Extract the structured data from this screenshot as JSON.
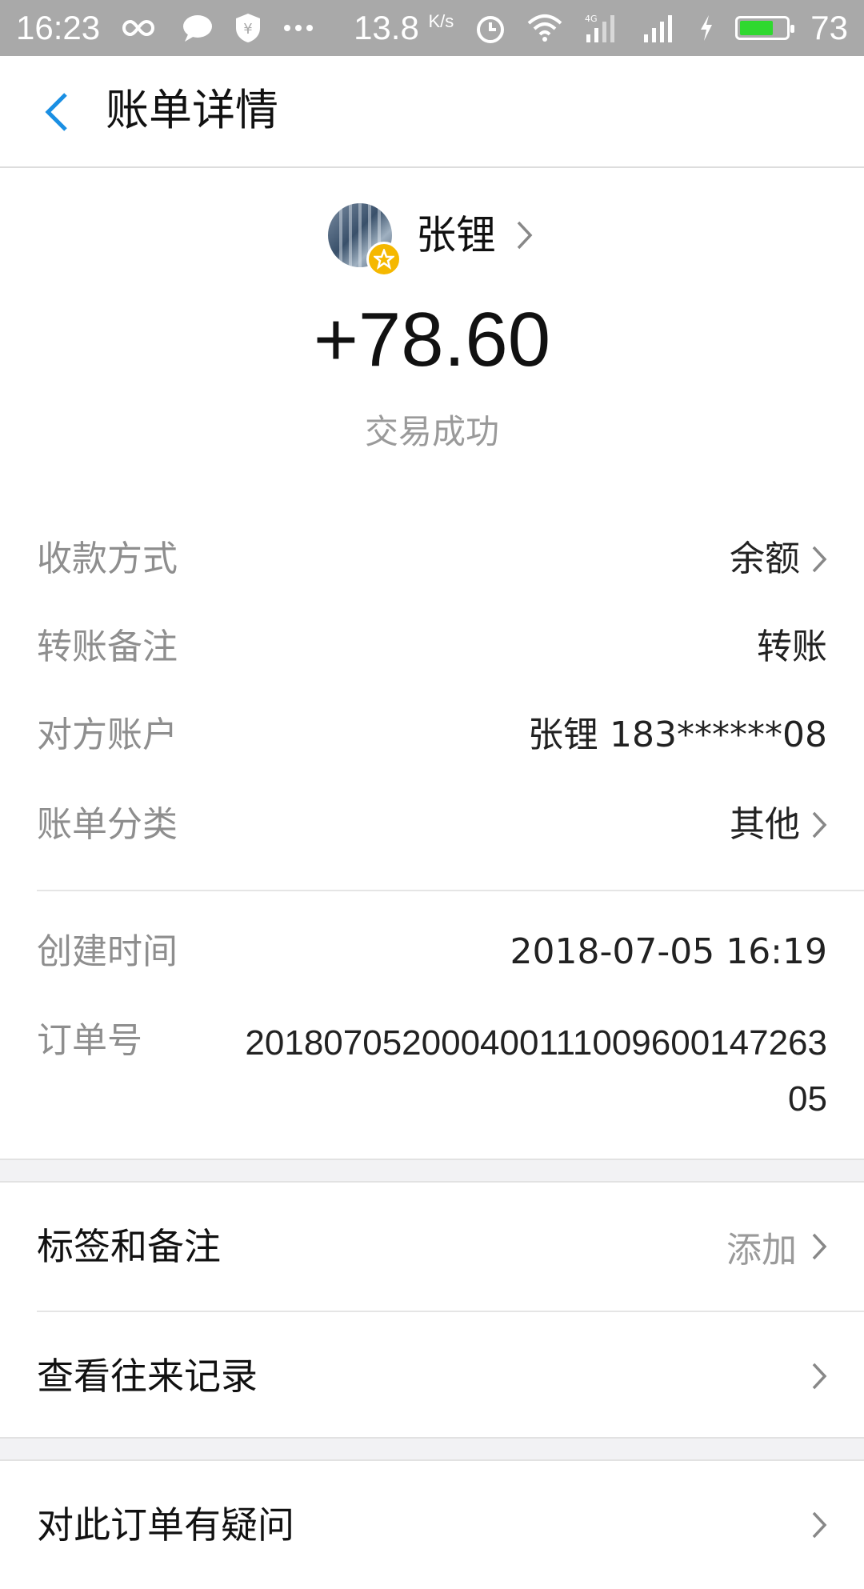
{
  "status_bar": {
    "time": "16:23",
    "net_speed": "13.8",
    "net_unit": "K/s",
    "battery": "73",
    "battery_fill": 0.73,
    "icons": [
      "infinity-icon",
      "chat-icon",
      "shield-yen-icon",
      "more-dots-icon",
      "alarm-icon",
      "wifi-icon",
      "4g-signal-icon",
      "signal-icon",
      "charging-icon",
      "battery-icon"
    ]
  },
  "header": {
    "title": "账单详情"
  },
  "profile": {
    "name": "张锂"
  },
  "transaction": {
    "amount": "+78.60",
    "status": "交易成功"
  },
  "details": [
    {
      "label": "收款方式",
      "value": "余额"
    },
    {
      "label": "转账备注",
      "value": "转账"
    },
    {
      "label": "对方账户",
      "value": "张锂 183******08"
    },
    {
      "label": "账单分类",
      "value": "其他"
    }
  ],
  "meta": {
    "created_label": "创建时间",
    "created_value": "2018-07-05 16:19",
    "order_label": "订单号",
    "order_value": "2018070520004001110096001472 6305",
    "order_line1": "201807052000400111009600147263",
    "order_line2": "05"
  },
  "actions": {
    "tags_label": "标签和备注",
    "tags_add": "添加",
    "history_label": "查看往来记录",
    "question_label": "对此订单有疑问"
  },
  "colors": {
    "accent": "#1a8fe3",
    "status_bar": "#a9a9a9",
    "badge": "#f5b800"
  }
}
